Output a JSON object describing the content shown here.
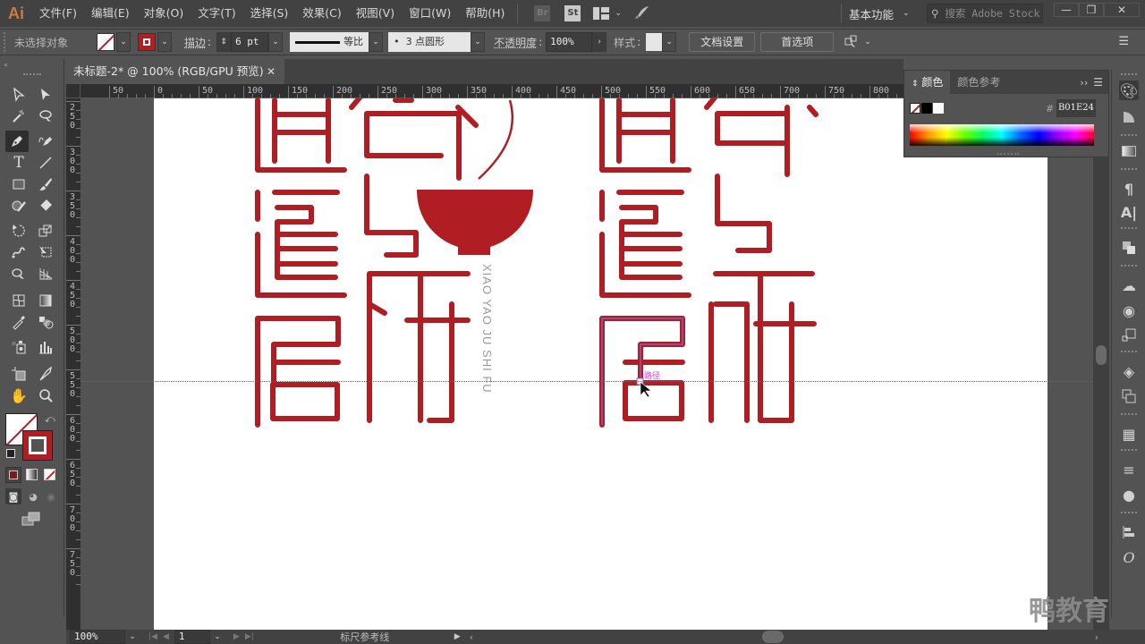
{
  "app": {
    "logo": "Ai",
    "accent": "#cc7a3d"
  },
  "menubar": {
    "items": [
      "文件(F)",
      "编辑(E)",
      "对象(O)",
      "文字(T)",
      "选择(S)",
      "效果(C)",
      "视图(V)",
      "窗口(W)",
      "帮助(H)"
    ],
    "bridge_label": "Br",
    "stock_label": "St",
    "workspace": "基本功能",
    "search_placeholder": "搜索 Adobe Stock",
    "minimize": "—",
    "restore": "❐",
    "close": "✕"
  },
  "controlbar": {
    "selection_status": "未选择对象",
    "stroke_label": "描边",
    "stroke_weight": "6 pt",
    "stroke_profile": "等比",
    "brush": "3 点圆形",
    "opacity_label": "不透明度",
    "opacity_value": "100%",
    "style_label": "样式",
    "doc_setup": "文档设置",
    "preferences": "首选项",
    "fill_color": "none",
    "stroke_color": "#B01E24"
  },
  "document": {
    "tab_title": "未标题-2* @ 100% (RGB/GPU 预览)",
    "close": "✕"
  },
  "rulers": {
    "horizontal": [
      "50",
      "0",
      "50",
      "100",
      "150",
      "200",
      "250",
      "300",
      "350",
      "400",
      "450",
      "500",
      "550",
      "600",
      "650",
      "700",
      "750",
      "800"
    ],
    "vertical": [
      "250",
      "300",
      "350",
      "400",
      "450",
      "500",
      "550",
      "600",
      "650",
      "700",
      "750"
    ]
  },
  "artwork": {
    "brand_color": "#B01E24",
    "vertical_text": "XIAO YAO JU SHI FU",
    "path_hint": "路径"
  },
  "color_panel": {
    "tabs": [
      "颜色",
      "颜色参考"
    ],
    "hash": "#",
    "hex": "B01E24"
  },
  "statusbar": {
    "zoom": "100%",
    "artboard": "1",
    "status": "标尺参考线"
  },
  "watermark": "鸭教育"
}
